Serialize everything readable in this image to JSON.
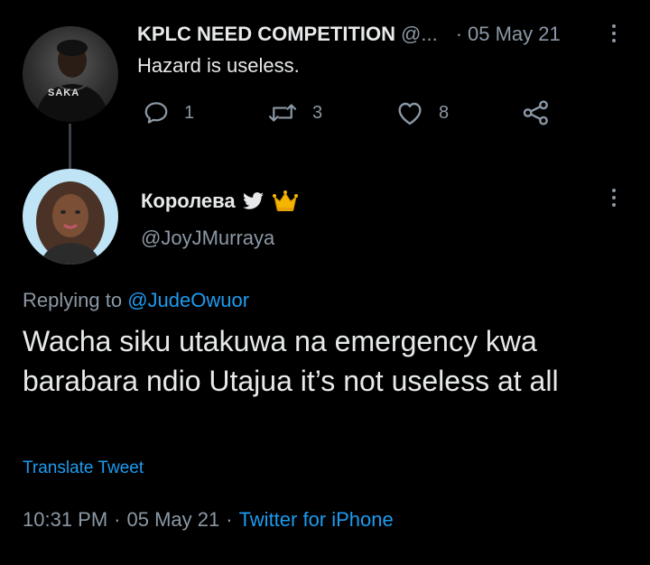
{
  "parent_tweet": {
    "display_name": "KPLC NEED COMPETITION",
    "handle": "@...",
    "separator": "·",
    "date": "05 May 21",
    "text": "Hazard is useless.",
    "avatar_jersey_text": "SAKA",
    "actions": [
      {
        "icon": "reply-icon",
        "count": "1"
      },
      {
        "icon": "retweet-icon",
        "count": "3"
      },
      {
        "icon": "like-icon",
        "count": "8"
      },
      {
        "icon": "share-icon",
        "count": ""
      }
    ]
  },
  "main_tweet": {
    "display_name": "Королева",
    "badges": [
      "twitter-bird-icon",
      "crown-icon"
    ],
    "handle": "@JoyJMurraya",
    "replying_prefix": "Replying to",
    "replying_to": "@JudeOwuor",
    "text": "Wacha siku utakuwa na emergency kwa barabara ndio Utajua it’s not useless at all",
    "translate_label": "Translate Tweet",
    "time": "10:31 PM",
    "separator": "·",
    "date": "05 May 21",
    "separator2": "·",
    "source": "Twitter for iPhone"
  },
  "colors": {
    "background": "#000000",
    "text": "#e7e9ea",
    "muted": "#8b98a5",
    "link": "#1d9bf0",
    "thread_line": "#3a4047"
  }
}
